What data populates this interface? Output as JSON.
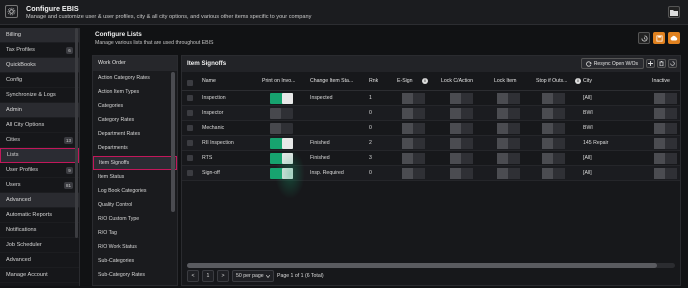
{
  "header": {
    "title": "Configure EBIS",
    "subtitle": "Manage and customize user & user profiles, city & all city options, and various other items specific to your company"
  },
  "sidebar": {
    "items": [
      {
        "type": "section",
        "label": "Billing"
      },
      {
        "type": "item",
        "label": "Tax Profiles",
        "badge": "6"
      },
      {
        "type": "section",
        "label": "QuickBooks"
      },
      {
        "type": "item",
        "label": "Config"
      },
      {
        "type": "item",
        "label": "Synchronize & Logs"
      },
      {
        "type": "section",
        "label": "Admin"
      },
      {
        "type": "item",
        "label": "All City Options"
      },
      {
        "type": "item",
        "label": "Cities",
        "badge": "13"
      },
      {
        "type": "item",
        "label": "Lists",
        "active": true
      },
      {
        "type": "item",
        "label": "User Profiles",
        "badge": "9"
      },
      {
        "type": "item",
        "label": "Users",
        "badge": "81"
      },
      {
        "type": "section",
        "label": "Advanced"
      },
      {
        "type": "item",
        "label": "Automatic Reports"
      },
      {
        "type": "item",
        "label": "Notifications"
      },
      {
        "type": "item",
        "label": "Job Scheduler"
      },
      {
        "type": "item",
        "label": "Advanced"
      },
      {
        "type": "item",
        "label": "Manage Account"
      }
    ]
  },
  "content": {
    "title": "Configure Lists",
    "subtitle": "Manage various lists that are used throughout EBIS"
  },
  "lists": {
    "header": "Work Order",
    "items": [
      "Action Category Rates",
      "Action Item Types",
      "Categories",
      "Category Rates",
      "Department Rates",
      "Departments",
      "Item Signoffs",
      "Item Status",
      "Log Book Categories",
      "Quality Control",
      "R/O Custom Type",
      "R/O Tag",
      "R/O Work Status",
      "Sub-Categories",
      "Sub-Category Rates"
    ],
    "active_index": 6
  },
  "grid": {
    "title": "Item Signoffs",
    "resync_label": "Resync Open W/Os",
    "columns": [
      "Name",
      "Print on Invo...",
      "Change Item Sta...",
      "Rnk",
      "E-Sign",
      "Lock C/Action",
      "Lock Item",
      "Stop if Outs...",
      "City",
      "Inactive"
    ],
    "rows": [
      {
        "name": "Inspection",
        "print": true,
        "change": "Inspected",
        "rank": "1",
        "city": "[All]"
      },
      {
        "name": "Inspector",
        "print": false,
        "change": "",
        "rank": "0",
        "city": "BWI"
      },
      {
        "name": "Mechanic",
        "print": false,
        "change": "",
        "rank": "0",
        "city": "BWI"
      },
      {
        "name": "RII Inspection",
        "print": true,
        "change": "Finished",
        "rank": "2",
        "city": "145 Repair"
      },
      {
        "name": "RTS",
        "print": true,
        "change": "Finished",
        "rank": "3",
        "city": "[All]"
      },
      {
        "name": "Sign-off",
        "print": true,
        "change": "Insp. Required",
        "rank": "0",
        "city": "[All]"
      }
    ],
    "pager": {
      "page": "1",
      "per_page": "50 per page",
      "summary": "Page 1 of 1 (6 Total)",
      "prev": "<",
      "next": ">"
    }
  },
  "icons": {
    "app": "gear-icon",
    "top_right": "folder-icon",
    "history": "history-icon",
    "save": "save-icon",
    "cloud": "cloud-icon",
    "sync": "sync-icon",
    "add": "plus-icon",
    "delete": "trash-icon",
    "refresh": "refresh-icon",
    "info": "info-icon"
  },
  "colors": {
    "accent_pink": "#c2185b",
    "toggle_on": "#17a36f",
    "orange": "#e0811f"
  }
}
